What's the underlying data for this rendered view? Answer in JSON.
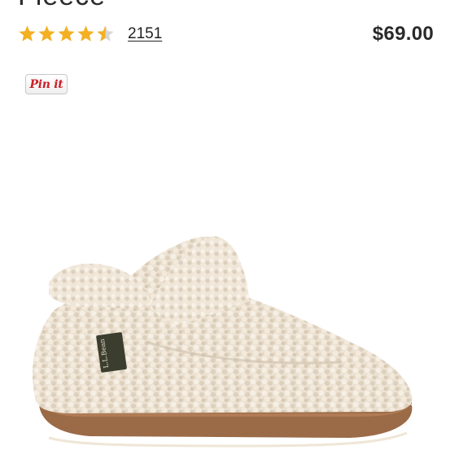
{
  "product": {
    "title_fragment": "Fleece",
    "rating": 4.5,
    "rating_max": 5,
    "review_count": "2151",
    "price": "$69.00"
  },
  "share": {
    "pinterest_label": "Pin it"
  },
  "image": {
    "tag_text": "L.L.Bean"
  },
  "colors": {
    "star": "#f3b023",
    "star_empty": "#d6d6d6",
    "pinterest": "#cb2027",
    "text": "#2a2a2a"
  }
}
